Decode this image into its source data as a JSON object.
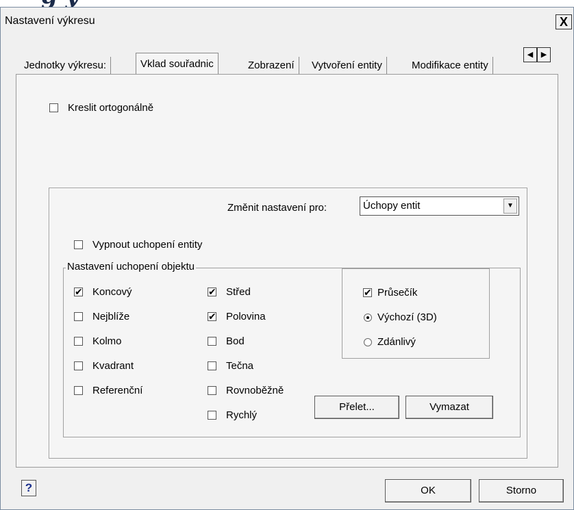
{
  "background": {
    "partial_text": "g y"
  },
  "dialog": {
    "title": "Nastavení výkresu",
    "close_label": "X"
  },
  "tabs": [
    {
      "label": "Jednotky výkresu:",
      "active": false
    },
    {
      "label": "Vklad souřadnic",
      "active": true
    },
    {
      "label": "Zobrazení",
      "active": false
    },
    {
      "label": "Vytvoření entity",
      "active": false
    },
    {
      "label": "Modifikace entity",
      "active": false
    }
  ],
  "tab_scroll": {
    "left": "◀",
    "right": "▶"
  },
  "page": {
    "orthogonal_label": "Kreslit ortogonálně",
    "orthogonal_checked": false,
    "change_settings_label": "Změnit nastavení pro:",
    "change_settings_value": "Úchopy entit",
    "disable_snap_label": "Vypnout uchopení entity",
    "disable_snap_checked": false,
    "snap_group_title": "Nastavení uchopení objektu",
    "snaps_col1": [
      {
        "label": "Koncový",
        "checked": true
      },
      {
        "label": "Nejblíže",
        "checked": false
      },
      {
        "label": "Kolmo",
        "checked": false
      },
      {
        "label": "Kvadrant",
        "checked": false
      },
      {
        "label": "Referenční",
        "checked": false
      }
    ],
    "snaps_col2": [
      {
        "label": "Střed",
        "checked": true
      },
      {
        "label": "Polovina",
        "checked": true
      },
      {
        "label": "Bod",
        "checked": false
      },
      {
        "label": "Tečna",
        "checked": false
      },
      {
        "label": "Rovnoběžně",
        "checked": false
      },
      {
        "label": "Rychlý",
        "checked": false
      }
    ],
    "intersection_label": "Průsečík",
    "intersection_checked": true,
    "radio_default_label": "Výchozí (3D)",
    "radio_apparent_label": "Zdánlivý",
    "radio_selected": "default",
    "flyover_button": "Přelet...",
    "clear_button": "Vymazat"
  },
  "footer": {
    "help_label": "?",
    "ok_label": "OK",
    "cancel_label": "Storno"
  }
}
